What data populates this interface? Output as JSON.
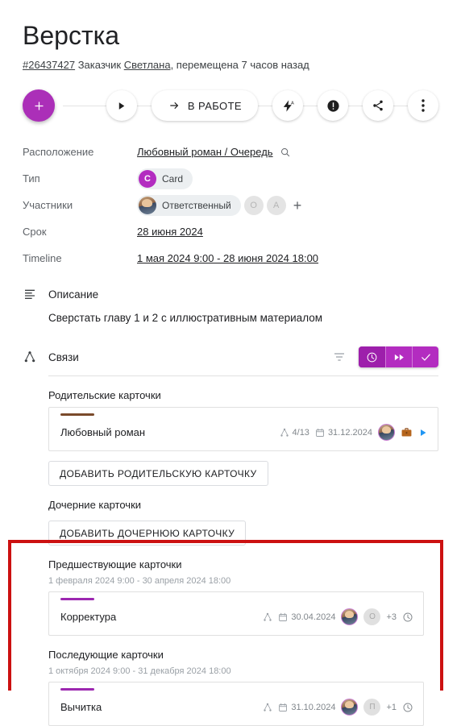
{
  "header": {
    "title": "Верстка",
    "id": "#26437427",
    "customer_label": "Заказчик",
    "customer_name": "Светлана",
    "moved_text": ", перемещена 7 часов назад"
  },
  "actionbar": {
    "add_label": "+",
    "play_icon": "play-icon",
    "status_label": "В РАБОТЕ",
    "arrow_icon": "arrow-right-icon",
    "automation_icon": "lightning-auto-icon",
    "priority_icon": "exclamation-icon",
    "share_icon": "share-icon",
    "more_icon": "more-vertical-icon"
  },
  "properties": [
    {
      "label": "Расположение",
      "value": "Любовный роман / Очередь",
      "type": "link-search"
    },
    {
      "label": "Тип",
      "value": "Card",
      "badge": "C",
      "type": "chip"
    },
    {
      "label": "Участники",
      "value": "Ответственный",
      "extra": [
        "О",
        "А"
      ],
      "type": "members"
    },
    {
      "label": "Срок",
      "value": "28 июня 2024",
      "type": "link"
    },
    {
      "label": "Timeline",
      "value": "1 мая 2024 9:00 - 28 июня 2024 18:00",
      "type": "link"
    }
  ],
  "description": {
    "section_title": "Описание",
    "icon": "text-lines-icon",
    "text": "Сверстать главу 1 и 2 с иллюстративным материалом"
  },
  "links": {
    "section_title": "Связи",
    "icon": "hierarchy-icon",
    "filter_icon": "filter-icon",
    "segmented": [
      {
        "name": "clock-icon",
        "active": true
      },
      {
        "name": "fast-forward-icon",
        "active": false
      },
      {
        "name": "check-icon",
        "active": false
      }
    ],
    "groups": [
      {
        "title": "Родительские карточки",
        "dates": "",
        "accent": "#7a4a2b",
        "cards": [
          {
            "name": "Любовный роман",
            "links_count": "4/13",
            "date": "31.12.2024",
            "has_avatar": true,
            "has_briefcase": true,
            "has_play": true
          }
        ],
        "add_button": "ДОБАВИТЬ РОДИТЕЛЬСКУЮ КАРТОЧКУ"
      },
      {
        "title": "Дочерние карточки",
        "dates": "",
        "cards": [],
        "add_button": "ДОБАВИТЬ ДОЧЕРНЮЮ КАРТОЧКУ"
      },
      {
        "title": "Предшествующие карточки",
        "dates": "1 февраля 2024 9:00 - 30 апреля 2024 18:00",
        "accent": "#9c27b0",
        "cards": [
          {
            "name": "Корректура",
            "links_count": "",
            "date": "30.04.2024",
            "has_avatar": true,
            "avatar_letter": "О",
            "plus_more": "+3",
            "has_clock": true
          }
        ],
        "add_button": ""
      },
      {
        "title": "Последующие карточки",
        "dates": "1 октября 2024 9:00 - 31 декабря 2024 18:00",
        "accent": "#9c27b0",
        "cards": [
          {
            "name": "Вычитка",
            "links_count": "",
            "date": "31.10.2024",
            "has_avatar": true,
            "avatar_letter": "П",
            "plus_more": "+1",
            "has_clock": true
          }
        ],
        "add_button": ""
      }
    ]
  },
  "colors": {
    "accent_purple": "#b32cc0",
    "fab_purple": "#ab2fb8",
    "highlight_red": "#cc1111",
    "parent_accent": "#7a4a2b",
    "card_accent": "#9c27b0"
  }
}
